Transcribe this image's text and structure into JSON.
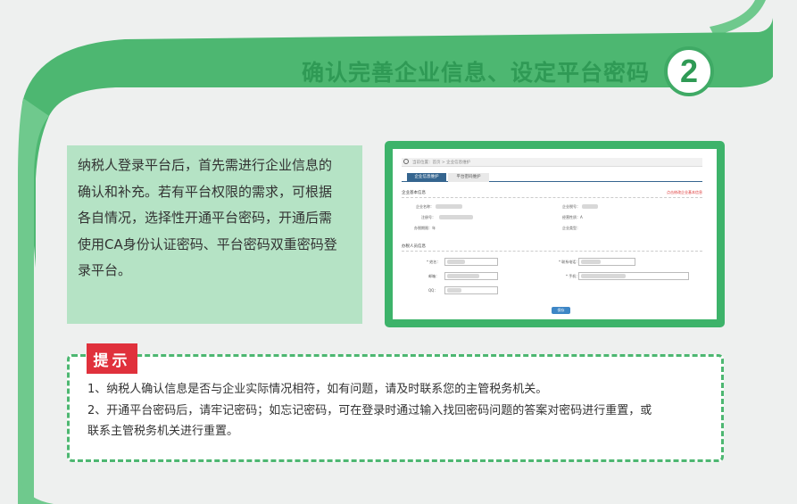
{
  "header": {
    "title": "确认完善企业信息、设定平台密码",
    "step_number": "2"
  },
  "description": {
    "lines": [
      "纳税人登录平台后，首先需进行企业信息的",
      "确认和补充。若有平台权限的需求，可根据",
      "各自情况，选择性开通平台密码，开通后需",
      "使用CA身份认证密码、平台密码双重密码登",
      "录平台。"
    ]
  },
  "screenshot": {
    "breadcrumb": "当前位置：首页 > 企业信息维护",
    "tabs": [
      "企业信息维护",
      "平台密码维护"
    ],
    "section_basic": "企业基本信息",
    "link_edit": "点击修改企业基本信息",
    "basic_labels": [
      "企业名称：",
      "企业税号：",
      "注册号：",
      "经营性质：A",
      "办税期限：年",
      "企业类型："
    ],
    "section_contact": "办税人员信息",
    "contact_labels": [
      "* 姓名：",
      "* 联系电话：",
      "邮箱：",
      "* 手机：",
      "QQ："
    ],
    "submit_label": "保存"
  },
  "tips": {
    "badge": "提示",
    "lines": [
      "1、纳税人确认信息是否与企业实际情况相符，如有问题，请及时联系您的主管税务机关。",
      "2、开通平台密码后，请牢记密码；如忘记密码，可在登录时通过输入找回密码问题的答案对密码进行重置，或",
      "联系主管税务机关进行重置。"
    ]
  },
  "colors": {
    "brand_green": "#3db36a",
    "title_green": "#2f9a55",
    "desc_bg": "#b5e3c5",
    "badge_red": "#e0313c"
  }
}
